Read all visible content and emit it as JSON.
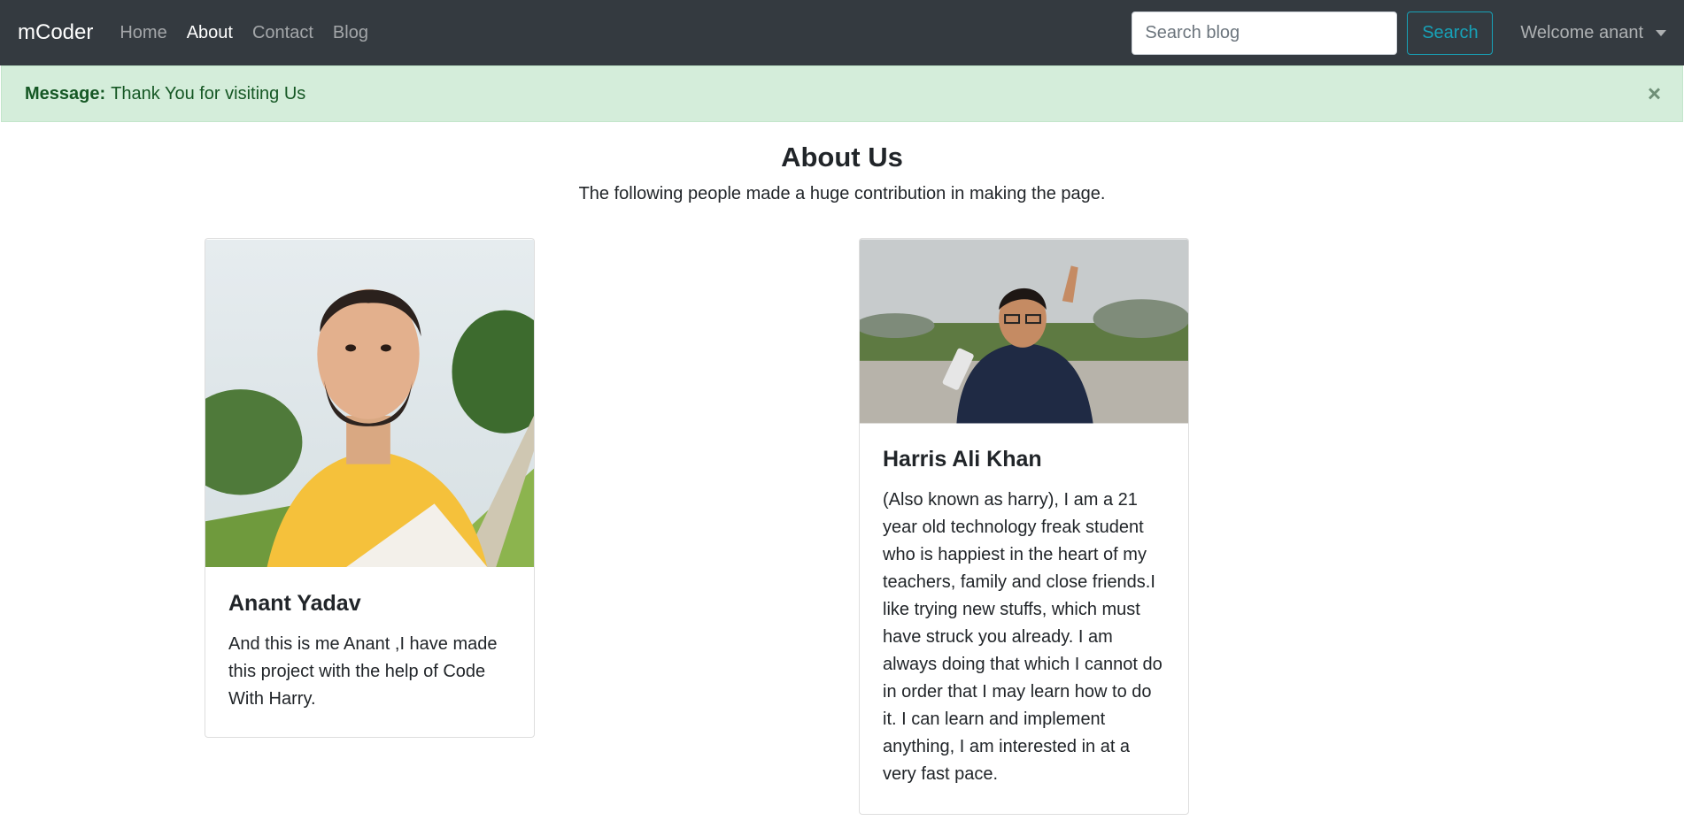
{
  "nav": {
    "brand": "mCoder",
    "links": [
      "Home",
      "About",
      "Contact",
      "Blog"
    ],
    "search_placeholder": "Search blog",
    "search_button": "Search",
    "welcome": "Welcome anant"
  },
  "alert": {
    "label": "Message:",
    "text": "Thank You for visiting Us",
    "close": "×"
  },
  "about": {
    "title": "About Us",
    "subtitle": "The following people made a huge contribution in making the page."
  },
  "cards": [
    {
      "name": "Anant Yadav",
      "text": "And this is me Anant ,I have made this project with the help of Code With Harry."
    },
    {
      "name": "Harris Ali Khan",
      "text": "(Also known as harry), I am a 21 year old technology freak student who is happiest in the heart of my teachers, family and close friends.I like trying new stuffs, which must have struck you already. I am always doing that which I cannot do in order that I may learn how to do it. I can learn and implement anything, I am interested in at a very fast pace."
    }
  ]
}
